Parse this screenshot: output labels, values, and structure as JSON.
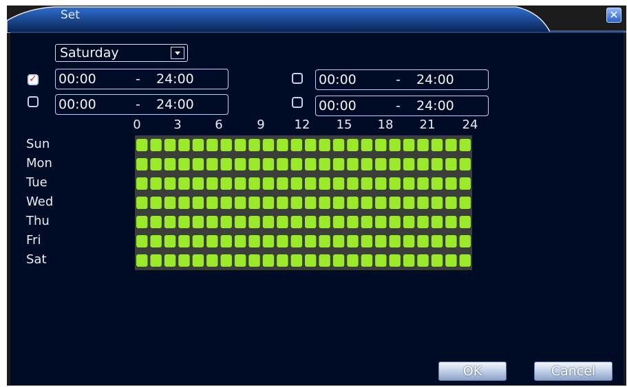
{
  "window": {
    "title": "Set",
    "close_icon": "close-icon"
  },
  "day_select": {
    "value": "Saturday",
    "icon": "chevron-down-icon"
  },
  "periods": [
    {
      "checked": true,
      "start": "00:00",
      "sep": "-",
      "end": "24:00"
    },
    {
      "checked": false,
      "start": "00:00",
      "sep": "-",
      "end": "24:00"
    },
    {
      "checked": false,
      "start": "00:00",
      "sep": "-",
      "end": "24:00"
    },
    {
      "checked": false,
      "start": "00:00",
      "sep": "-",
      "end": "24:00"
    }
  ],
  "schedule": {
    "hour_labels": [
      "0",
      "3",
      "6",
      "9",
      "12",
      "15",
      "18",
      "21",
      "24"
    ],
    "days": [
      "Sun",
      "Mon",
      "Tue",
      "Wed",
      "Thu",
      "Fri",
      "Sat"
    ],
    "active_color": "#9bea2a",
    "all_hours_active": true
  },
  "buttons": {
    "ok": "OK",
    "cancel": "Cancel"
  },
  "colors": {
    "panel_bg": "#000b26",
    "title_bar": "#1a4fa0",
    "field_border": "#bcd2f7"
  }
}
